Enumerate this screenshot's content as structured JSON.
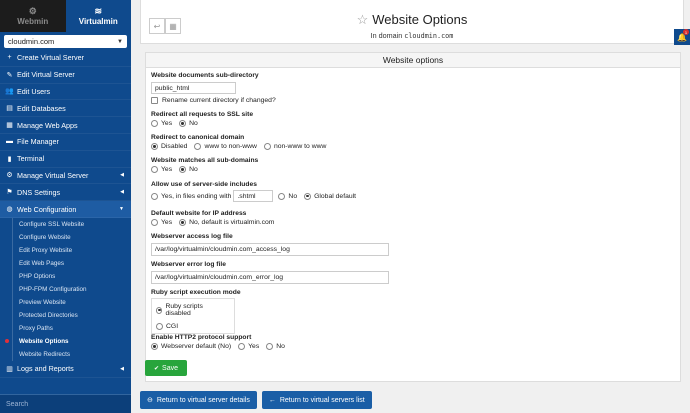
{
  "sidebar": {
    "tabs": [
      {
        "label": "Webmin",
        "icon": "webmin-icon"
      },
      {
        "label": "Virtualmin",
        "icon": "virtualmin-icon"
      }
    ],
    "domain_select": "cloudmin.com",
    "menu": [
      {
        "label": "Create Virtual Server",
        "icon": "plus-icon"
      },
      {
        "label": "Edit Virtual Server",
        "icon": "edit-icon"
      },
      {
        "label": "Edit Users",
        "icon": "users-icon"
      },
      {
        "label": "Edit Databases",
        "icon": "database-icon"
      },
      {
        "label": "Manage Web Apps",
        "icon": "webapps-icon"
      },
      {
        "label": "File Manager",
        "icon": "folder-icon"
      },
      {
        "label": "Terminal",
        "icon": "terminal-icon"
      },
      {
        "label": "Manage Virtual Server",
        "icon": "gear-icon"
      },
      {
        "label": "DNS Settings",
        "icon": "dns-icon"
      },
      {
        "label": "Web Configuration",
        "icon": "globe-icon"
      }
    ],
    "submenu": [
      "Configure SSL Website",
      "Configure Website",
      "Edit Proxy Website",
      "Edit Web Pages",
      "PHP Options",
      "PHP-FPM Configuration",
      "Preview Website",
      "Protected Directories",
      "Proxy Paths",
      "Website Options",
      "Website Redirects"
    ],
    "logs": {
      "label": "Logs and Reports",
      "icon": "chart-icon"
    },
    "search_placeholder": "Search"
  },
  "header": {
    "title": "Website Options",
    "subtitle_prefix": "In domain",
    "subtitle_domain": "cloudmin.com"
  },
  "panel": {
    "heading": "Website options",
    "docs_subdir": {
      "label": "Website documents sub-directory",
      "value": "public_html",
      "rename_label": "Rename current directory if changed?"
    },
    "ssl_redirect": {
      "label": "Redirect all requests to SSL site",
      "yes": "Yes",
      "no": "No"
    },
    "canonical": {
      "label": "Redirect to canonical domain",
      "opt1": "Disabled",
      "opt2": "www to non-www",
      "opt3": "non-www to www"
    },
    "subdomains": {
      "label": "Website matches all sub-domains",
      "yes": "Yes",
      "no": "No"
    },
    "ssi": {
      "label": "Allow use of server-side includes",
      "opt1": "Yes, in files ending with",
      "value": ".shtml",
      "opt2": "No",
      "opt3": "Global default"
    },
    "default_site": {
      "label": "Default website for IP address",
      "yes": "Yes",
      "no": "No, default is virtualmin.com"
    },
    "access_log": {
      "label": "Webserver access log file",
      "value": "/var/log/virtualmin/cloudmin.com_access_log"
    },
    "error_log": {
      "label": "Webserver error log file",
      "value": "/var/log/virtualmin/cloudmin.com_error_log"
    },
    "ruby": {
      "label": "Ruby script execution mode",
      "opt1": "Ruby scripts disabled",
      "opt2": "CGI"
    },
    "http2": {
      "label": "Enable HTTP2 protocol support",
      "opt1": "Webserver default (No)",
      "opt2": "Yes",
      "opt3": "No"
    },
    "save_label": "Save"
  },
  "footer": {
    "return_details": "Return to virtual server details",
    "return_list": "Return to virtual servers list"
  },
  "notification_count": "1"
}
